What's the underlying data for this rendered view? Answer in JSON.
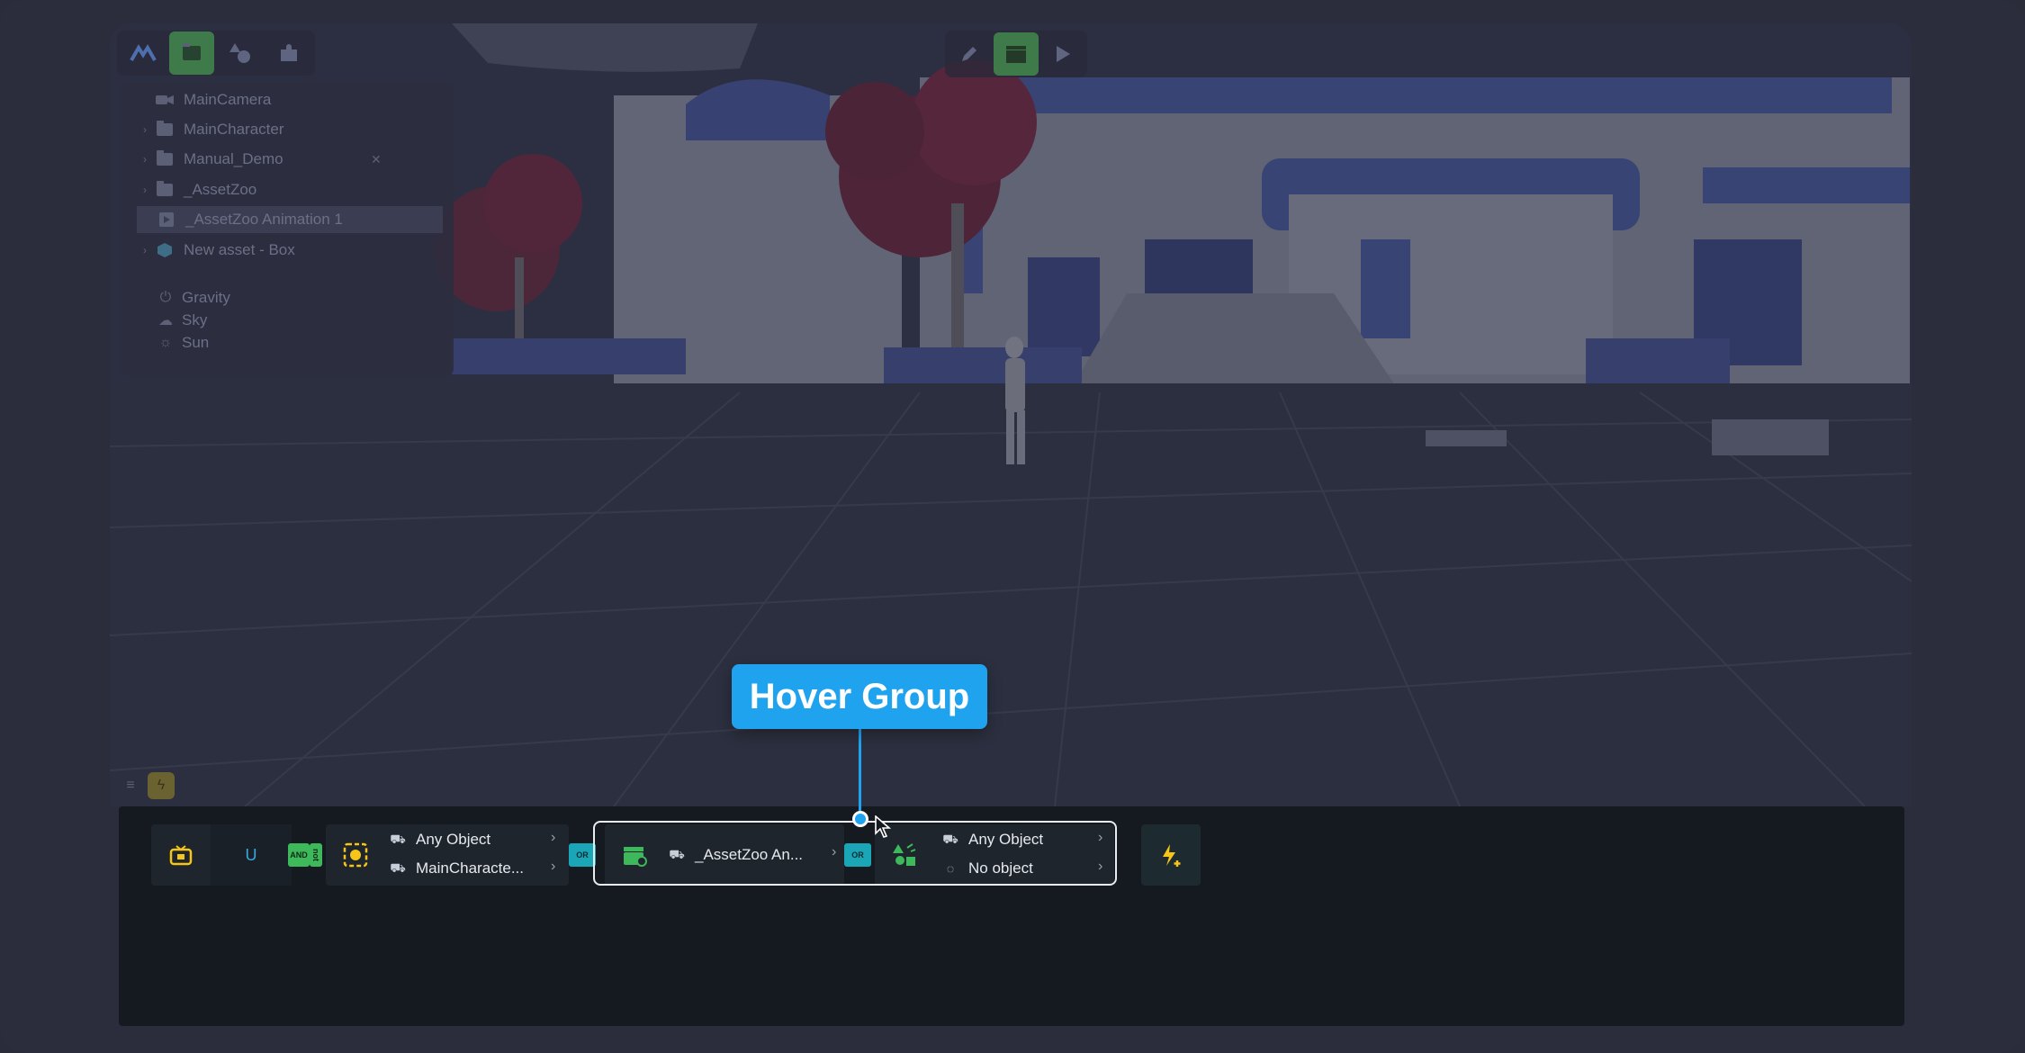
{
  "outliner": {
    "items": [
      {
        "label": "MainCamera",
        "icon": "camera-icon",
        "has_arrow": false
      },
      {
        "label": "MainCharacter",
        "icon": "folder-icon",
        "has_arrow": true
      },
      {
        "label": "Manual_Demo",
        "icon": "folder-icon",
        "has_arrow": true
      },
      {
        "label": "_AssetZoo",
        "icon": "folder-icon",
        "has_arrow": true
      },
      {
        "label": "_AssetZoo Animation 1",
        "icon": "animation-icon",
        "has_arrow": false,
        "selected": true
      },
      {
        "label": "New asset - Box",
        "icon": "cube-icon",
        "has_arrow": true
      }
    ],
    "environment": [
      {
        "label": "Gravity",
        "icon": "gravity-icon"
      },
      {
        "label": "Sky",
        "icon": "cloud-icon"
      },
      {
        "label": "Sun",
        "icon": "sun-icon"
      }
    ]
  },
  "rule": {
    "trigger_letter": "U",
    "and_label": "AND",
    "not_label": "not",
    "or_label_1": "OR",
    "or_label_2": "OR",
    "condition_1_line_1": "Any Object",
    "condition_1_line_2": "MainCharacte...",
    "animation_label": "_AssetZoo An...",
    "condition_2_line_1": "Any Object",
    "condition_2_line_2": "No object"
  },
  "callout": {
    "text": "Hover Group"
  },
  "colors": {
    "accent_blue": "#1fa3ef",
    "green_active": "#3f7a4a",
    "yellow": "#f5c518",
    "teal": "#1aa6b7"
  }
}
